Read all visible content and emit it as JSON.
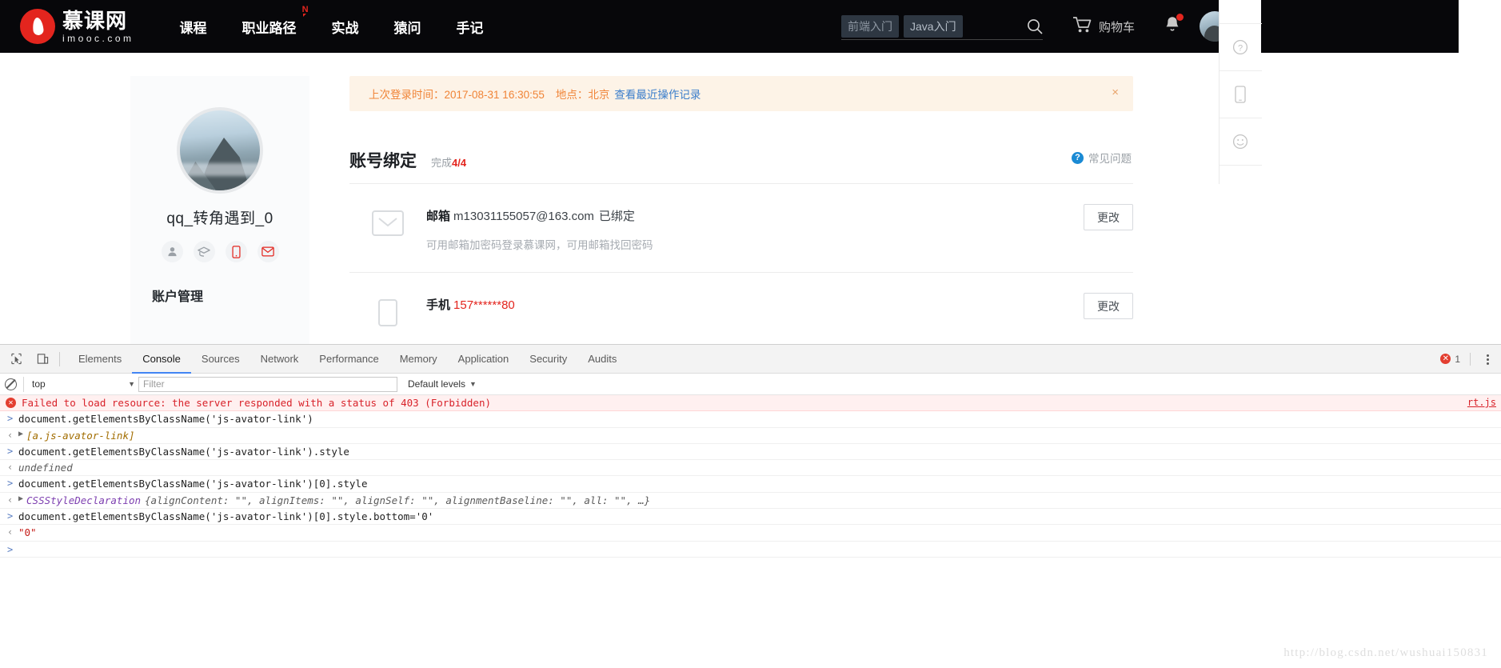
{
  "site": {
    "logo_cn": "慕课网",
    "logo_en": "imooc.com",
    "nav": [
      {
        "label": "课程",
        "badge": ""
      },
      {
        "label": "职业路径",
        "badge": "N"
      },
      {
        "label": "实战",
        "badge": ""
      },
      {
        "label": "猿问",
        "badge": ""
      },
      {
        "label": "手记",
        "badge": ""
      }
    ],
    "search": {
      "placeholder": "",
      "tags": [
        "前端入门",
        "Java入门"
      ]
    },
    "cart_label": "购物车"
  },
  "profile": {
    "username": "qq_转角遇到_0",
    "badges": [
      "person-icon",
      "graduation-icon",
      "phone-icon",
      "envelope-icon"
    ],
    "menu_title": "账户管理"
  },
  "notice": {
    "prefix": "上次登录时间：2017-08-31 16:30:55",
    "location": "地点：北京",
    "link": "查看最近操作记录",
    "close": "×"
  },
  "binding": {
    "title": "账号绑定",
    "progress_prefix": "完成",
    "progress": "4/4",
    "faq": "常见问题",
    "faq_icon": "question-icon",
    "rows": [
      {
        "icon": "mail-icon",
        "label": "邮箱",
        "value": "m13031155057@163.com",
        "value_red": false,
        "state": "已绑定",
        "desc": "可用邮箱加密码登录慕课网，可用邮箱找回密码",
        "button": "更改"
      },
      {
        "icon": "mobile-icon",
        "label": "手机",
        "value": "157******80",
        "value_red": true,
        "state": "",
        "desc": "",
        "button": "更改"
      }
    ]
  },
  "devtools": {
    "tabs": [
      "Elements",
      "Console",
      "Sources",
      "Network",
      "Performance",
      "Memory",
      "Application",
      "Security",
      "Audits"
    ],
    "active_tab": "Console",
    "error_count": "1",
    "filter": {
      "context": "top",
      "placeholder": "Filter",
      "levels": "Default levels"
    },
    "console": [
      {
        "kind": "error",
        "text": "Failed to load resource: the server responded with a status of 403 (Forbidden)",
        "source": "rt.js"
      },
      {
        "kind": "input",
        "text": "document.getElementsByClassName('js-avator-link')"
      },
      {
        "kind": "output-array",
        "text": "[a.js-avator-link]"
      },
      {
        "kind": "input",
        "text": "document.getElementsByClassName('js-avator-link').style"
      },
      {
        "kind": "output",
        "text": "undefined"
      },
      {
        "kind": "input",
        "text": "document.getElementsByClassName('js-avator-link')[0].style"
      },
      {
        "kind": "output-object",
        "cls": "CSSStyleDeclaration",
        "text": "{alignContent: \"\", alignItems: \"\", alignSelf: \"\", alignmentBaseline: \"\", all: \"\", …}"
      },
      {
        "kind": "input",
        "text": "document.getElementsByClassName('js-avator-link')[0].style.bottom='0'"
      },
      {
        "kind": "output-string",
        "text": "\"0\""
      },
      {
        "kind": "prompt",
        "text": ""
      }
    ]
  },
  "watermark": "http://blog.csdn.net/wushuai150831",
  "colors": {
    "brand_red": "#e3251e",
    "header_bg": "#07070a",
    "notice_bg": "#fdf3e7",
    "notice_text": "#f08437",
    "link_blue": "#3b7ecb",
    "devtools_accent": "#4285f4"
  }
}
